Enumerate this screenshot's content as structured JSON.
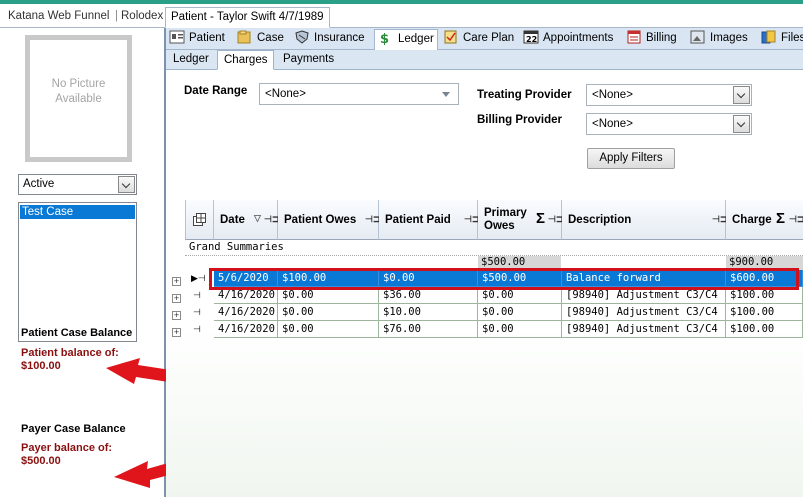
{
  "top_tabs": [
    {
      "label": "Katana Web Funnel"
    },
    {
      "label": "Rolodex"
    },
    {
      "label": "Patient - Taylor Swift 4/7/1989"
    }
  ],
  "sidebar": {
    "photo_text_1": "No Picture",
    "photo_text_2": "Available",
    "status": "Active",
    "cases": [
      "Test Case"
    ],
    "patient_case_balance_heading": "Patient Case Balance",
    "patient_balance_text": "Patient balance of: $100.00",
    "payer_case_balance_heading": "Payer Case Balance",
    "payer_balance_text": "Payer balance of: $500.00"
  },
  "module_tabs": [
    "Patient",
    "Case",
    "Insurance",
    "Ledger",
    "Care Plan",
    "Appointments",
    "Billing",
    "Images",
    "Files"
  ],
  "sub_tabs": [
    "Ledger",
    "Charges",
    "Payments"
  ],
  "filters": {
    "date_range_label": "Date Range",
    "date_range_value": "<None>",
    "treating_provider_label": "Treating Provider",
    "treating_provider_value": "<None>",
    "billing_provider_label": "Billing Provider",
    "billing_provider_value": "<None>",
    "apply_label": "Apply Filters"
  },
  "grid": {
    "columns": [
      "Date",
      "Patient Owes",
      "Patient Paid",
      "Primary Owes",
      "Description",
      "Charge"
    ],
    "grand_summaries_label": "Grand Summaries",
    "summary_primary_owes": "$500.00",
    "summary_charge": "$900.00",
    "rows": [
      {
        "date": "5/6/2020",
        "patient_owes": "$100.00",
        "patient_paid": "$0.00",
        "primary_owes": "$500.00",
        "description": "Balance forward",
        "charge": "$600.00"
      },
      {
        "date": "4/16/2020",
        "patient_owes": "$0.00",
        "patient_paid": "$36.00",
        "primary_owes": "$0.00",
        "description": "[98940] Adjustment C3/C4",
        "charge": "$100.00"
      },
      {
        "date": "4/16/2020",
        "patient_owes": "$0.00",
        "patient_paid": "$10.00",
        "primary_owes": "$0.00",
        "description": "[98940] Adjustment C3/C4",
        "charge": "$100.00"
      },
      {
        "date": "4/16/2020",
        "patient_owes": "$0.00",
        "patient_paid": "$76.00",
        "primary_owes": "$0.00",
        "description": "[98940] Adjustment C3/C4",
        "charge": "$100.00"
      }
    ],
    "selected_row": 0
  },
  "colors": {
    "accent": "#2aa089",
    "selection": "#0a79d6",
    "highlight_box": "#d0101a",
    "balance_text": "#8a1010",
    "arrow": "#e0151c"
  }
}
